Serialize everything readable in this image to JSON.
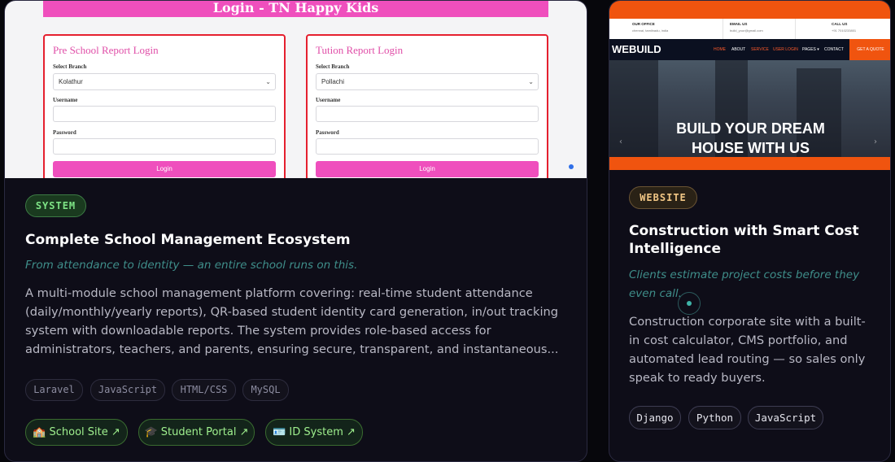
{
  "cards": [
    {
      "preview": {
        "banner": "Login - TN Happy Kids",
        "forms": [
          {
            "title": "Pre School Report Login",
            "branch_label": "Select Branch",
            "branch_value": "Kolathur",
            "username_label": "Username",
            "password_label": "Password",
            "button": "Login"
          },
          {
            "title": "Tution Report Login",
            "branch_label": "Select Branch",
            "branch_value": "Pollachi",
            "username_label": "Username",
            "password_label": "Password",
            "button": "Login"
          }
        ]
      },
      "badge": "SYSTEM",
      "title": "Complete School Management Ecosystem",
      "tagline": "From attendance to identity — an entire school runs on this.",
      "description": "A multi-module school management platform covering: real-time student attendance (daily/monthly/yearly reports), QR-based student identity card generation, in/out tracking system with downloadable reports. The system provides role-based access for administrators, teachers, and parents, ensuring secure, transparent, and instantaneous...",
      "tech": [
        "Laravel",
        "JavaScript",
        "HTML/CSS",
        "MySQL"
      ],
      "links": [
        {
          "icon": "🏫",
          "label": "School Site",
          "arrow": "↗"
        },
        {
          "icon": "🎓",
          "label": "Student Portal",
          "arrow": "↗"
        },
        {
          "icon": "🪪",
          "label": "ID System",
          "arrow": "↗"
        }
      ]
    },
    {
      "preview": {
        "topbar": [
          {
            "heading": "OUR OFFICE",
            "value": "chennai, tamilnadu, india"
          },
          {
            "heading": "EMAIL US",
            "value": "build_your@gmail.com"
          },
          {
            "heading": "CALL US",
            "value": "+91 7010233801"
          }
        ],
        "logo": "WEBUILD",
        "nav": [
          "HOME",
          "ABOUT",
          "SERVICE",
          "USER LOGIN",
          "PAGES ▾",
          "CONTACT"
        ],
        "cta": "GET A QUOTE",
        "hero_line1": "BUILD YOUR DREAM",
        "hero_line2": "HOUSE WITH US"
      },
      "badge": "WEBSITE",
      "title": "Construction with Smart Cost Intelligence",
      "tagline": "Clients estimate project costs before they even call.",
      "description": "Construction corporate site with a built-in cost calculator, CMS portfolio, and automated lead routing — so sales only speak to ready buyers.",
      "tech": [
        "Django",
        "Python",
        "JavaScript"
      ]
    }
  ],
  "colors": {
    "system_badge": "#7ee486",
    "website_badge": "#f2c785",
    "tagline": "#3f8e8a",
    "preview_pink": "#ef4fbd",
    "preview_orange": "#f0540f"
  }
}
